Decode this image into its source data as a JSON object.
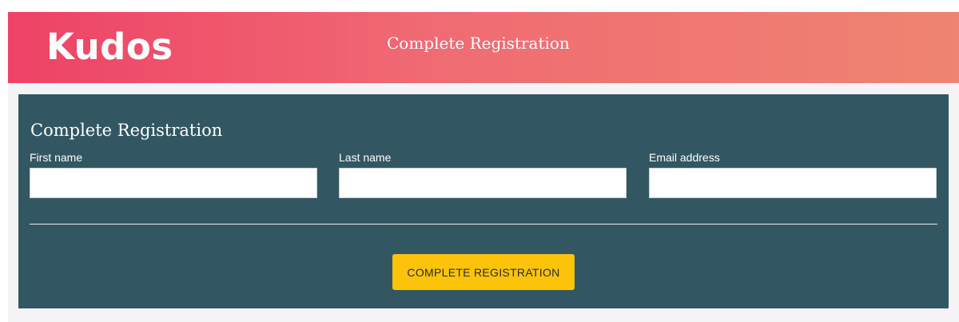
{
  "header": {
    "logo_text": "Kudos",
    "title": "Complete Registration"
  },
  "form": {
    "title": "Complete Registration",
    "fields": [
      {
        "label": "First name",
        "value": "",
        "placeholder": ""
      },
      {
        "label": "Last name",
        "value": "",
        "placeholder": ""
      },
      {
        "label": "Email address",
        "value": "",
        "placeholder": ""
      }
    ],
    "submit_label": "COMPLETE REGISTRATION"
  },
  "colors": {
    "header_gradient_start": "#ee4266",
    "header_gradient_end": "#ef8471",
    "panel_background": "#325763",
    "button_background": "#fbc30a",
    "page_band": "#f4f4f6"
  }
}
